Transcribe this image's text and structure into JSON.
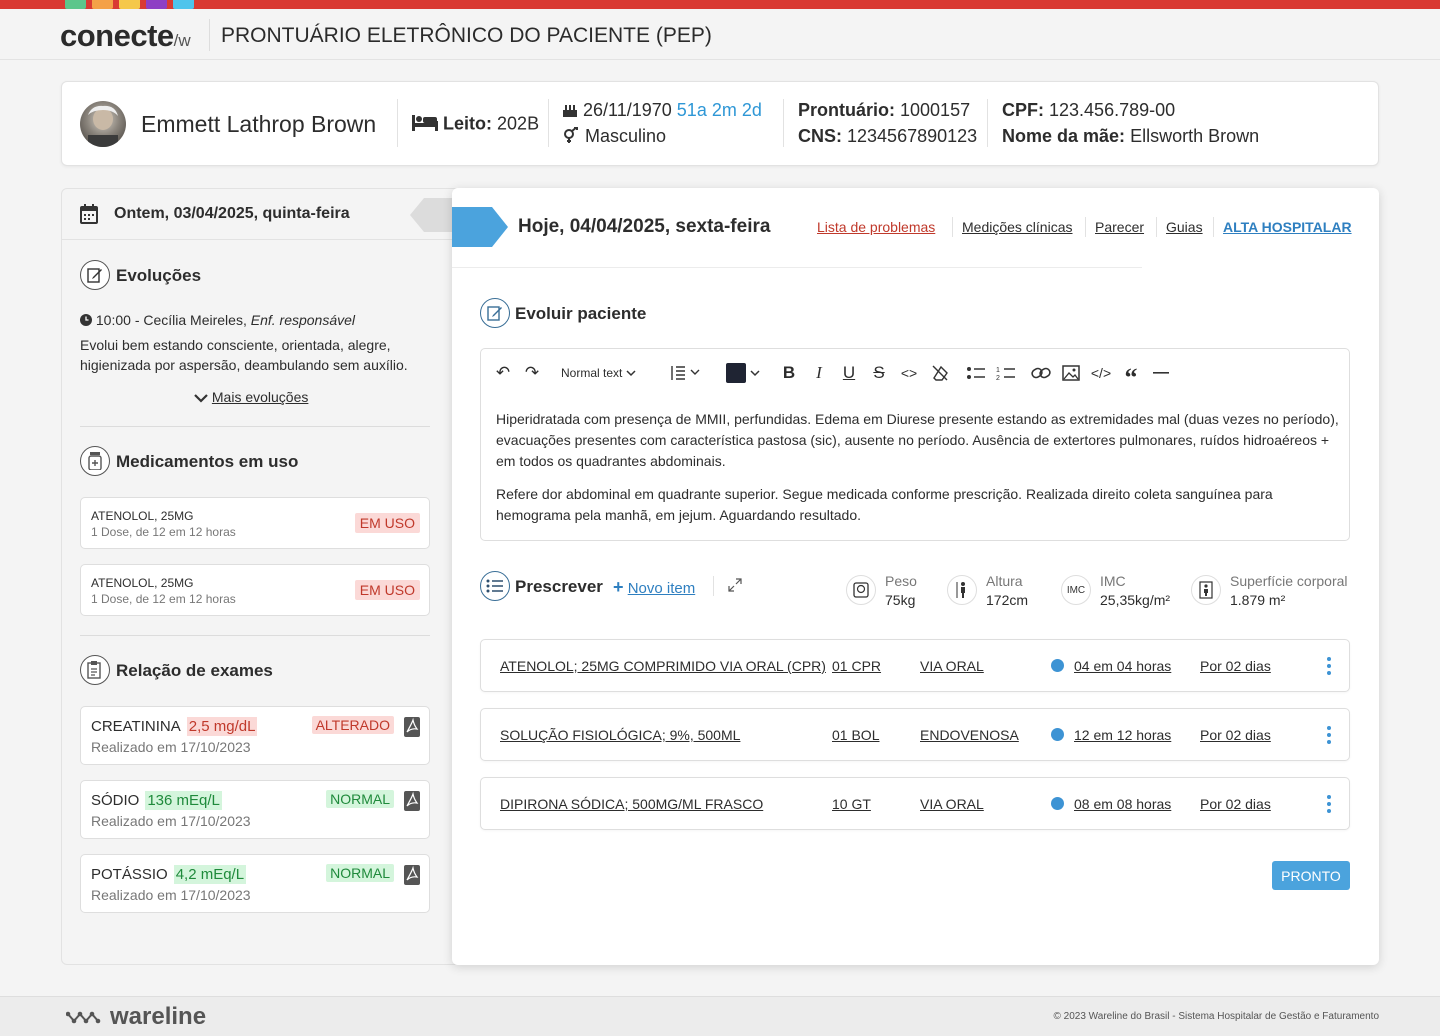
{
  "colors": {
    "stripe_red": "#d93a33",
    "swatches": [
      "#5cc68b",
      "#f4a147",
      "#f5c84a",
      "#8e3fc4",
      "#4ec4ec"
    ],
    "accent_blue": "#4ba3dd",
    "link_red": "#c0392b",
    "link_blue": "#2e7fc0"
  },
  "header": {
    "logo_main": "conecte",
    "logo_suffix": "/w",
    "title": "PRONTUÁRIO ELETRÔNICO DO PACIENTE (PEP)"
  },
  "patient": {
    "name": "Emmett Lathrop Brown",
    "leito_label": "Leito:",
    "leito": "202B",
    "birthdate": "26/11/1970",
    "age": "51a 2m 2d",
    "sex": "Masculino",
    "prontuario_label": "Prontuário:",
    "prontuario": "1000157",
    "cns_label": "CNS:",
    "cns": "1234567890123",
    "cpf_label": "CPF:",
    "cpf": "123.456.789-00",
    "mae_label": "Nome da mãe:",
    "mae": "Ellsworth Brown"
  },
  "left": {
    "date": "Ontem, 03/04/2025, quinta-feira",
    "evolucoes_title": "Evoluções",
    "evo_time": "10:00 - Cecília Meireles, ",
    "evo_role": "Enf. responsável",
    "evo_text": "Evolui bem estando consciente, orientada, alegre, higienizada por aspersão, deambulando sem auxílio.",
    "mais": "Mais evoluções",
    "meds_title": "Medicamentos em uso",
    "meds": [
      {
        "name": "ATENOLOL, 25MG",
        "dose": "1 Dose, de 12 em 12 horas",
        "status": "EM USO"
      },
      {
        "name": "ATENOLOL, 25MG",
        "dose": "1 Dose, de 12 em 12 horas",
        "status": "EM USO"
      }
    ],
    "exams_title": "Relação de exames",
    "exams": [
      {
        "name": "CREATININA",
        "value": "2,5 mg/dL",
        "date": "Realizado em 17/10/2023",
        "status": "ALTERADO"
      },
      {
        "name": "SÓDIO",
        "value": "136 mEq/L",
        "date": "Realizado em 17/10/2023",
        "status": "NORMAL"
      },
      {
        "name": "POTÁSSIO",
        "value": "4,2 mEq/L",
        "date": "Realizado em 17/10/2023",
        "status": "NORMAL"
      }
    ]
  },
  "main": {
    "date": "Hoje, 04/04/2025, sexta-feira",
    "nav": [
      "Lista de problemas",
      "Medições clínicas",
      "Parecer",
      "Guias",
      "ALTA HOSPITALAR"
    ],
    "evoluir_title": "Evoluir paciente",
    "toolbar": {
      "text_style": "Normal text"
    },
    "editor_p1": "Hiperidratada com presença de MMII, perfundidas. Edema em Diurese presente estando as extremidades mal (duas vezes no período), evacuações presentes com característica pastosa (sic), ausente no período. Ausência de extertores pulmonares, ruídos hidroaéreos + em todos os quadrantes abdominais.",
    "editor_p2": "Refere dor abdominal em quadrante superior. Segue medicada conforme prescrição. Realizada direito coleta sanguínea para hemograma pela manhã, em jejum. Aguardando resultado.",
    "prescrever_title": "Prescrever",
    "novo_item": "Novo item",
    "metrics": [
      {
        "label": "Peso",
        "value": "75kg",
        "icon": "scale-icon"
      },
      {
        "label": "Altura",
        "value": "172cm",
        "icon": "height-icon"
      },
      {
        "label": "IMC",
        "value": "25,35kg/m²",
        "icon": "imc-icon",
        "icon_text": "IMC"
      },
      {
        "label": "Superfície corporal",
        "value": "1.879 m²",
        "icon": "body-surface-icon"
      }
    ],
    "prescriptions": [
      {
        "drug": "ATENOLOL; 25MG COMPRIMIDO VIA ORAL (CPR)",
        "qty": "01 CPR",
        "route": "VIA ORAL",
        "freq": "04 em 04 horas",
        "dur": "Por 02 dias"
      },
      {
        "drug": "SOLUÇÃO FISIOLÓGICA; 9%, 500ML",
        "qty": "01 BOL",
        "route": "ENDOVENOSA",
        "freq": "12 em 12 horas",
        "dur": "Por 02 dias"
      },
      {
        "drug": "DIPIRONA SÓDICA; 500MG/ML FRASCO",
        "qty": "10 GT",
        "route": "VIA ORAL",
        "freq": "08 em 08 horas",
        "dur": "Por 02 dias"
      }
    ],
    "pronto": "PRONTO"
  },
  "footer": {
    "logo": "wareline",
    "copyright": "© 2023 Wareline do Brasil - Sistema Hospitalar de Gestão e Faturamento"
  }
}
